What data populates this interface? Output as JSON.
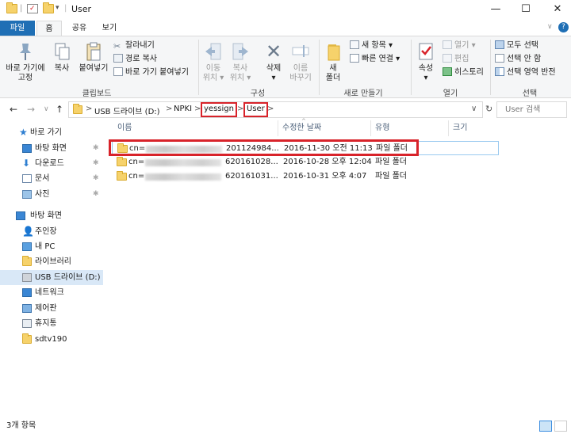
{
  "window": {
    "title": "User",
    "quick_access_sep": "|",
    "qa_dropdown": "▾",
    "minimize": "—",
    "maximize": "☐",
    "close": "✕",
    "help": "?"
  },
  "tabs": [
    "파일",
    "홈",
    "공유",
    "보기"
  ],
  "ribbon": {
    "clipboard": {
      "pin_label_1": "바로 가기에",
      "pin_label_2": "고정",
      "copy": "복사",
      "paste": "붙여넣기",
      "cut": "잘라내기",
      "copy_path": "경로 복사",
      "paste_shortcut": "바로 가기 붙여넣기",
      "group": "클립보드"
    },
    "organize": {
      "move_1": "이동",
      "move_2": "위치 ▾",
      "copyto_1": "복사",
      "copyto_2": "위치 ▾",
      "delete_1": "삭제",
      "delete_2": "▾",
      "rename_1": "이름",
      "rename_2": "바꾸기",
      "group": "구성"
    },
    "new": {
      "new_folder_1": "새",
      "new_folder_2": "폴더",
      "new_item": "새 항목 ▾",
      "easy_access": "빠른 연결 ▾",
      "group": "새로 만들기"
    },
    "open": {
      "properties_1": "속성",
      "properties_2": "▾",
      "open": "열기 ▾",
      "edit": "편집",
      "history": "히스토리",
      "group": "열기"
    },
    "select": {
      "select_all": "모두 선택",
      "select_none": "선택 안 함",
      "invert": "선택 영역 반전",
      "group": "선택"
    }
  },
  "address": {
    "back": "←",
    "forward": "→",
    "recent": "∨",
    "up": "↑",
    "crumbs": [
      "USB 드라이브 (D:)",
      "NPKI",
      "yessign",
      "User"
    ],
    "sep": ">",
    "dropdown": "∨",
    "refresh": "↻",
    "search_placeholder": "User 검색"
  },
  "sidebar": {
    "items": [
      {
        "label": "바로 가기",
        "pinned": false
      },
      {
        "label": "바탕 화면",
        "pinned": true
      },
      {
        "label": "다운로드",
        "pinned": true
      },
      {
        "label": "문서",
        "pinned": true
      },
      {
        "label": "사진",
        "pinned": true
      },
      {
        "label": "바탕 화면",
        "pinned": false
      },
      {
        "label": "주인장",
        "pinned": false
      },
      {
        "label": "내 PC",
        "pinned": false
      },
      {
        "label": "라이브러리",
        "pinned": false
      },
      {
        "label": "USB 드라이브 (D:)",
        "pinned": false
      },
      {
        "label": "네트워크",
        "pinned": false
      },
      {
        "label": "제어판",
        "pinned": false
      },
      {
        "label": "휴지통",
        "pinned": false
      },
      {
        "label": "sdtv190",
        "pinned": false
      }
    ],
    "pin_glyph": "📌"
  },
  "filelist": {
    "headers": {
      "name": "이름",
      "date": "수정한 날짜",
      "type": "유형",
      "size": "크기"
    },
    "sort_arrow": "^",
    "rows": [
      {
        "name_prefix": "cn=",
        "name_tail": "201124984...",
        "date": "2016-11-30 오전 11:13",
        "type": "파일 폴더"
      },
      {
        "name_prefix": "cn=",
        "name_tail": "620161028...",
        "date": "2016-10-28 오후 12:04",
        "type": "파일 폴더"
      },
      {
        "name_prefix": "cn=",
        "name_tail": "620161031...",
        "date": "2016-10-31 오후 4:07",
        "type": "파일 폴더"
      }
    ]
  },
  "status": {
    "count": "3개 항목"
  },
  "colors": {
    "accent": "#1f6fb5",
    "highlight": "#d8232a",
    "selected": "#cce4f7"
  }
}
